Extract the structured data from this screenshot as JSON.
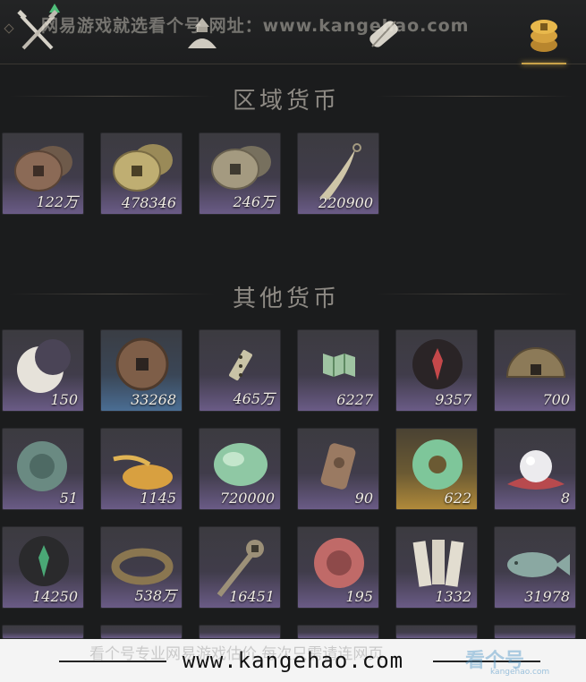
{
  "watermark_top": "网易游戏就选看个号   网址：www.kangehao.com",
  "tabs": [
    {
      "icon": "crossed-swords-icon"
    },
    {
      "icon": "pouch-icon"
    },
    {
      "icon": "scroll-icon"
    },
    {
      "icon": "coins-icon"
    }
  ],
  "sections": [
    {
      "title": "区域货币",
      "items": [
        {
          "icon": "copper-coins-icon",
          "qty": "122万",
          "rarity": "purple"
        },
        {
          "icon": "gold-coins-icon",
          "qty": "478346",
          "rarity": "purple"
        },
        {
          "icon": "silver-coins-icon",
          "qty": "246万",
          "rarity": "purple"
        },
        {
          "icon": "curved-blade-icon",
          "qty": "220900",
          "rarity": "purple"
        }
      ]
    },
    {
      "title": "其他货币",
      "items": [
        {
          "icon": "crescent-jade-icon",
          "qty": "150",
          "rarity": "purple"
        },
        {
          "icon": "bronze-coin-icon",
          "qty": "33268",
          "rarity": "blue"
        },
        {
          "icon": "token-strip-icon",
          "qty": "465万",
          "rarity": "purple"
        },
        {
          "icon": "map-token-icon",
          "qty": "6227",
          "rarity": "purple"
        },
        {
          "icon": "red-sigil-icon",
          "qty": "9357",
          "rarity": "purple"
        },
        {
          "icon": "half-coin-icon",
          "qty": "700",
          "rarity": "purple"
        },
        {
          "icon": "jade-disc-icon",
          "qty": "51",
          "rarity": "purple"
        },
        {
          "icon": "golden-grain-icon",
          "qty": "1145",
          "rarity": "purple"
        },
        {
          "icon": "jade-stone-icon",
          "qty": "720000",
          "rarity": "purple"
        },
        {
          "icon": "bronze-tablet-icon",
          "qty": "90",
          "rarity": "purple"
        },
        {
          "icon": "jade-ring-icon",
          "qty": "622",
          "rarity": "gold"
        },
        {
          "icon": "pearl-icon",
          "qty": "8",
          "rarity": "purple"
        },
        {
          "icon": "green-sigil-icon",
          "qty": "14250",
          "rarity": "purple"
        },
        {
          "icon": "coin-string-icon",
          "qty": "538万",
          "rarity": "purple"
        },
        {
          "icon": "coin-sword-icon",
          "qty": "16451",
          "rarity": "purple"
        },
        {
          "icon": "red-stone-icon",
          "qty": "195",
          "rarity": "purple"
        },
        {
          "icon": "bamboo-slips-icon",
          "qty": "1332",
          "rarity": "purple"
        },
        {
          "icon": "jade-fish-icon",
          "qty": "31978",
          "rarity": "purple"
        }
      ]
    }
  ],
  "footer": {
    "ghost_text": "看个号专业网易游戏估价 每次只需请连网页",
    "url": "www.kangehao.com",
    "logo": "看个号",
    "logo_sub": "kangehao.com"
  }
}
